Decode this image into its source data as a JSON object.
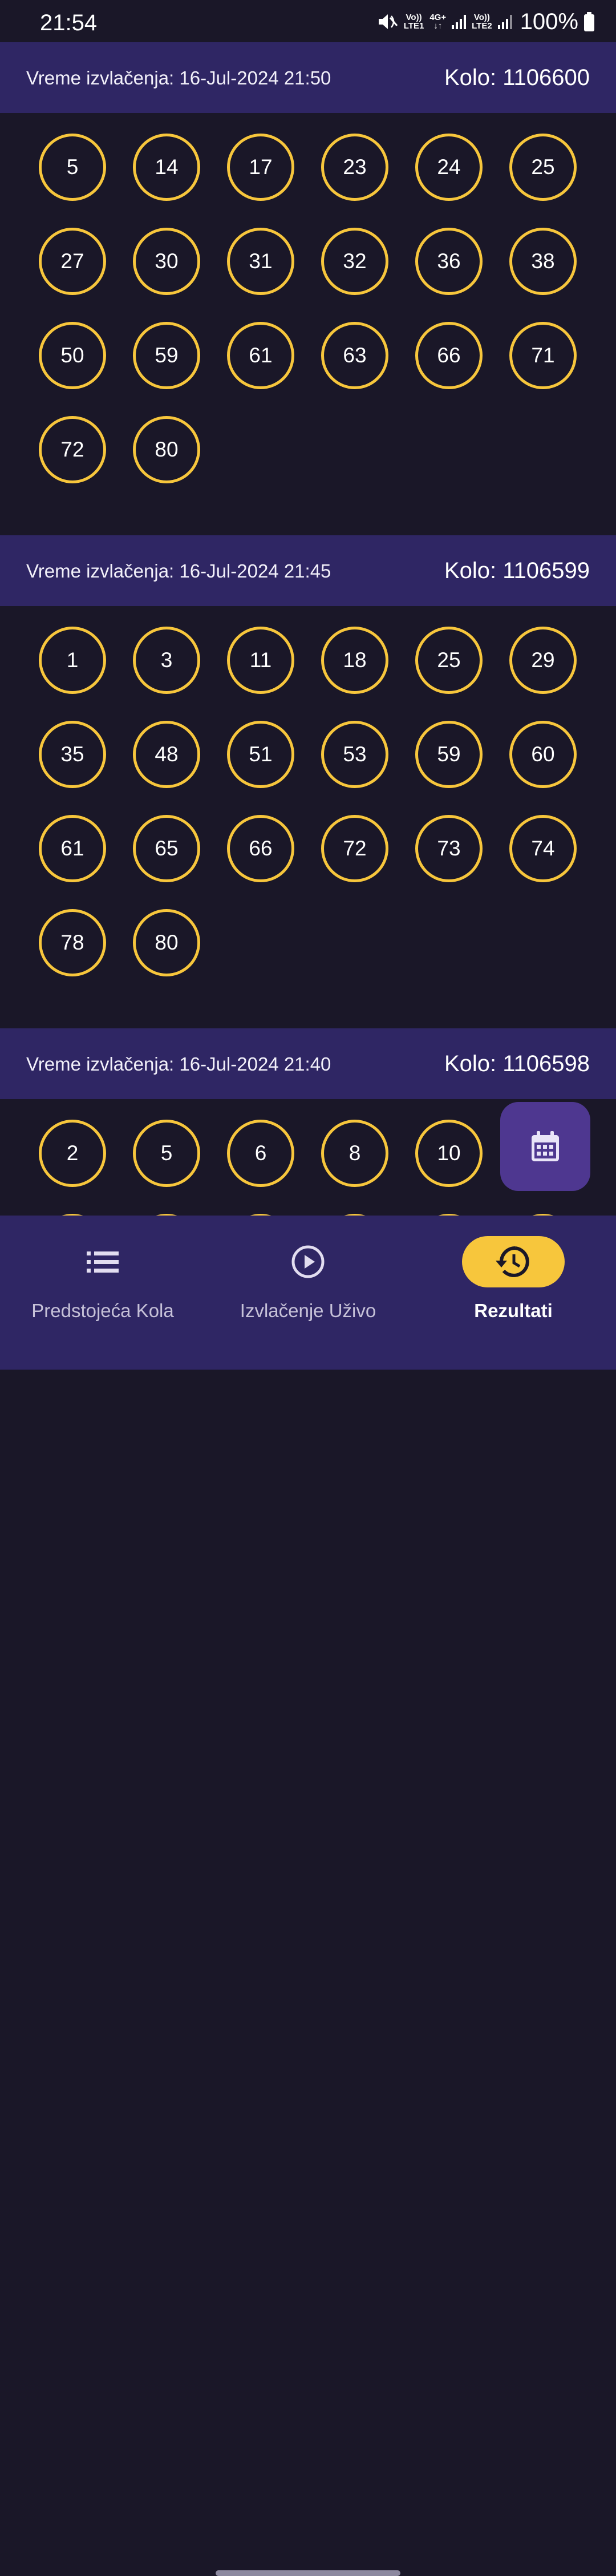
{
  "status_bar": {
    "time": "21:54",
    "sim1_top": "Vo))",
    "sim1_bottom": "LTE1",
    "net_top": "4G+",
    "net_bottom": "↓↑",
    "sim2_top": "Vo))",
    "sim2_bottom": "LTE2",
    "battery": "100%",
    "icons": [
      "mute-icon",
      "signal-icon",
      "signal-icon",
      "battery-icon"
    ]
  },
  "rounds": [
    {
      "time_label": "Vreme izvlačenja: 16-Jul-2024 21:50",
      "kolo_label": "Kolo: 1106600",
      "numbers": [
        "5",
        "14",
        "17",
        "23",
        "24",
        "25",
        "27",
        "30",
        "31",
        "32",
        "36",
        "38",
        "50",
        "59",
        "61",
        "63",
        "66",
        "71",
        "72",
        "80"
      ]
    },
    {
      "time_label": "Vreme izvlačenja: 16-Jul-2024 21:45",
      "kolo_label": "Kolo: 1106599",
      "numbers": [
        "1",
        "3",
        "11",
        "18",
        "25",
        "29",
        "35",
        "48",
        "51",
        "53",
        "59",
        "60",
        "61",
        "65",
        "66",
        "72",
        "73",
        "74",
        "78",
        "80"
      ]
    },
    {
      "time_label": "Vreme izvlačenja: 16-Jul-2024 21:40",
      "kolo_label": "Kolo: 1106598",
      "numbers": [
        "2",
        "5",
        "6",
        "8",
        "10"
      ]
    }
  ],
  "fab": {
    "icon": "calendar-icon"
  },
  "bottom_nav": {
    "items": [
      {
        "label": "Predstojeća Kola",
        "icon": "list-icon",
        "active": false
      },
      {
        "label": "Izvlačenje Uživo",
        "icon": "play-circle-icon",
        "active": false
      },
      {
        "label": "Rezultati",
        "icon": "history-icon",
        "active": true
      }
    ]
  },
  "colors": {
    "background": "#1a1728",
    "header": "#2f2664",
    "ball_border": "#f7c63c",
    "fab": "#4e3790",
    "active_pill": "#f7c63c"
  }
}
